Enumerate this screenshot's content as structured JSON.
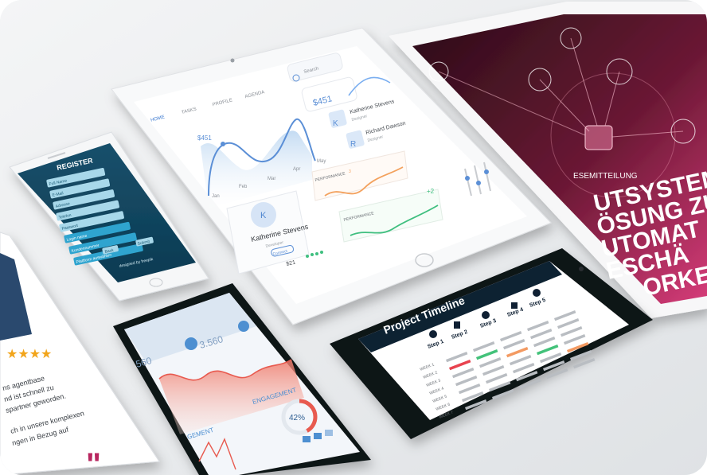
{
  "register_phone": {
    "title": "REGISTER",
    "fields": [
      "Full Name",
      "E-Mail",
      "Adresse",
      "Telefon",
      "Passwort",
      "Login name",
      "Kundennummer",
      "Plattform auswählen"
    ],
    "back_label": "Back",
    "submit_label": "Submit",
    "footer": "designed by freepik"
  },
  "dashboard_tablet": {
    "tabs": [
      "HOME",
      "TASKS",
      "PROFILE",
      "AGENDA"
    ],
    "top_search": "Search",
    "stat_value": "$451",
    "chart_label": "$451",
    "months": [
      "Jan",
      "Feb",
      "Mar",
      "Apr",
      "May"
    ],
    "contacts": [
      {
        "initial": "K",
        "name": "Katherine Stevens",
        "sub": "Designer"
      },
      {
        "initial": "R",
        "name": "Richard Dawson",
        "sub": "Designer"
      }
    ],
    "profile_initial": "K",
    "profile_name": "Katherine Stevens",
    "profile_role": "Developer",
    "profile_button": "Connect",
    "profile_amount": "$21",
    "perf_cards": [
      {
        "title": "PERFORMANCE",
        "value": "3"
      },
      {
        "title": "PERFORMANCE",
        "value": "+2"
      }
    ]
  },
  "press_tablet": {
    "label": "ESEMITTEILUNG",
    "headline_lines": [
      "UTSYSTEMS",
      "ÖSUNG ZU",
      "UTOMAT",
      "ESCHÄ",
      "ORKE"
    ]
  },
  "review_phone": {
    "lines": [
      "ns agentbase",
      "nd ist schnell zu",
      "spartner geworden.",
      "ch in unsere komplexen",
      "ngen in Bezug auf"
    ]
  },
  "analytics_phone": {
    "stats": [
      "560",
      "3.560"
    ],
    "engagement_label": "ENGAGEMENT",
    "engagement_left": "GEMENT",
    "percent": "42%",
    "percent_value": 42
  },
  "timeline_phone": {
    "title": "Project Timeline",
    "steps": [
      "Step 1",
      "Step 2",
      "Step 3",
      "Step 4",
      "Step 5"
    ],
    "weeks": [
      "WEEK 1",
      "WEEK 2",
      "WEEK 3",
      "WEEK 4",
      "WEEK 5",
      "WEEK 6",
      "WEEK 7"
    ],
    "colors": {
      "dark": "#0f2033",
      "orange": "#f39a62",
      "red": "#e8434f",
      "green": "#43c27a",
      "pink": "#e94b8f"
    }
  }
}
